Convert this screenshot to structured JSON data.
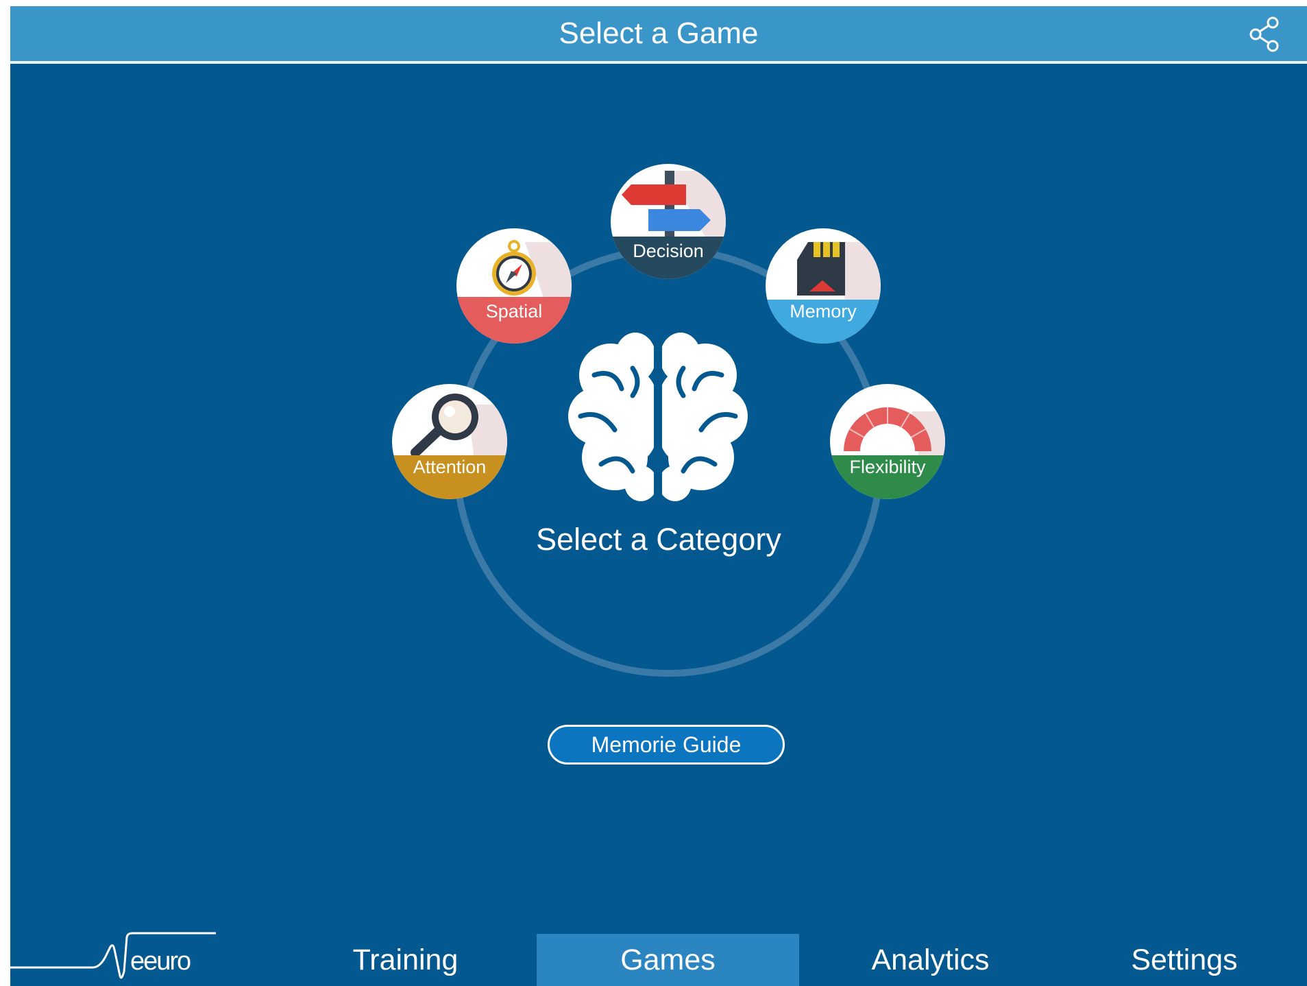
{
  "header": {
    "title": "Select a Game",
    "share_icon": "share-icon"
  },
  "categories": [
    {
      "label": "Decision",
      "icon": "signpost-icon",
      "color": "#25495f"
    },
    {
      "label": "Spatial",
      "icon": "compass-icon",
      "color": "#e45d5c"
    },
    {
      "label": "Memory",
      "icon": "memory-card-icon",
      "color": "#3fa9e0"
    },
    {
      "label": "Attention",
      "icon": "magnifier-icon",
      "color": "#c8901e"
    },
    {
      "label": "Flexibility",
      "icon": "spring-icon",
      "color": "#2e8b4a"
    }
  ],
  "center": {
    "icon": "brain-icon",
    "prompt": "Select a Category"
  },
  "guide_button": {
    "label": "Memorie Guide"
  },
  "brand": {
    "name": "Neeuro",
    "text": "eeuro"
  },
  "nav": {
    "tabs": [
      "Training",
      "Games",
      "Analytics",
      "Settings"
    ],
    "active": "Games"
  },
  "colors": {
    "background": "#03598f",
    "header": "#3a95c8",
    "active_tab": "#2b85c1",
    "button": "#0c75bf"
  }
}
